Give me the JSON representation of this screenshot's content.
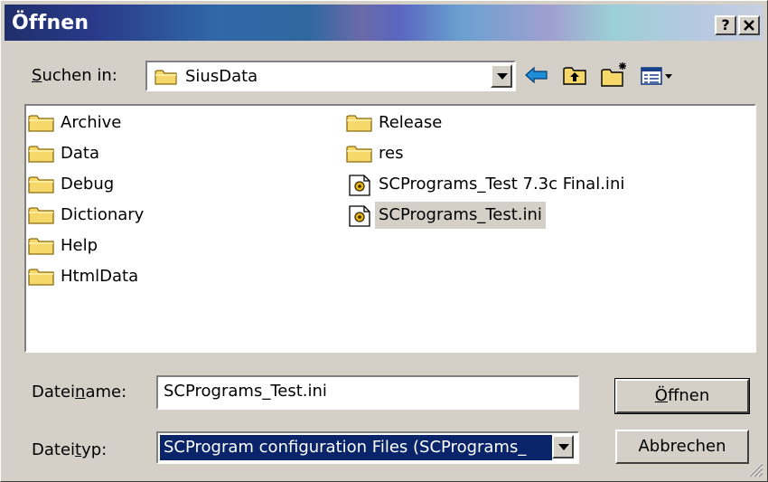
{
  "dialog": {
    "title": "Öffnen",
    "help_button": "?",
    "close_button": "X"
  },
  "look_in": {
    "label_prefix": "",
    "label_underlined": "S",
    "label_rest": "uchen in:",
    "value": "SiusData"
  },
  "toolbar": {
    "back_icon": "back-arrow-icon",
    "up_icon": "up-folder-icon",
    "new_folder_icon": "new-folder-icon",
    "view_icon": "view-menu-icon"
  },
  "files": {
    "column1": [
      {
        "name": "Archive",
        "type": "folder"
      },
      {
        "name": "Data",
        "type": "folder"
      },
      {
        "name": "Debug",
        "type": "folder"
      },
      {
        "name": "Dictionary",
        "type": "folder"
      },
      {
        "name": "Help",
        "type": "folder"
      },
      {
        "name": "HtmlData",
        "type": "folder"
      }
    ],
    "column2": [
      {
        "name": "Release",
        "type": "folder"
      },
      {
        "name": "res",
        "type": "folder"
      },
      {
        "name": "SCPrograms_Test 7.3c Final.ini",
        "type": "ini"
      },
      {
        "name": "SCPrograms_Test.ini",
        "type": "ini",
        "selected": true
      }
    ]
  },
  "filename": {
    "label_prefix": "Datei",
    "label_underlined": "n",
    "label_rest": "ame:",
    "value": "SCPrograms_Test.ini"
  },
  "filetype": {
    "label_prefix": "Datei",
    "label_underlined": "t",
    "label_rest": "yp:",
    "value": "SCProgram configuration Files (SCPrograms_"
  },
  "buttons": {
    "open_prefix": "",
    "open_underlined": "Ö",
    "open_rest": "ffnen",
    "cancel": "Abbrechen"
  }
}
